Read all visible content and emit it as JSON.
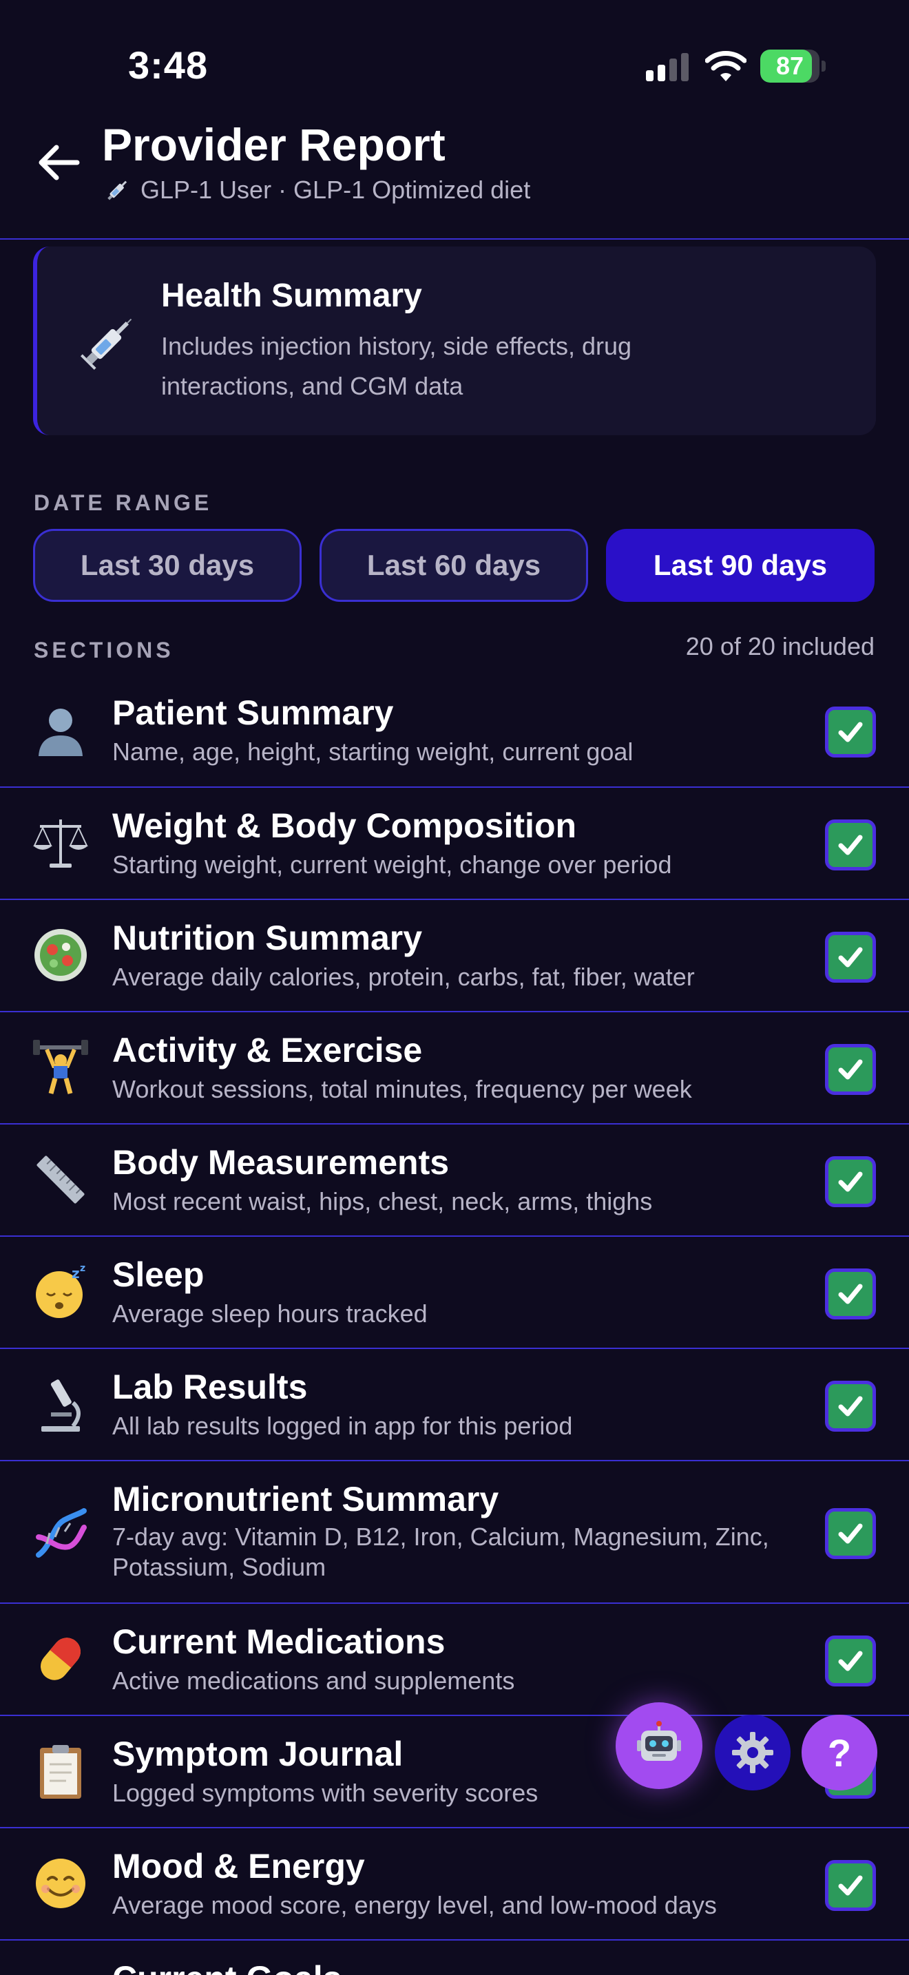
{
  "status_bar": {
    "time": "3:48",
    "battery": "87",
    "battery_level": 0.87
  },
  "header": {
    "title": "Provider Report",
    "subtitle": "GLP-1 User · GLP-1 Optimized diet"
  },
  "health_summary": {
    "title": "Health Summary",
    "description": "Includes injection history, side effects, drug interactions, and CGM data"
  },
  "date_range": {
    "label": "DATE RANGE",
    "options": [
      "Last 30 days",
      "Last 60 days",
      "Last 90 days"
    ],
    "selected": "Last 90 days"
  },
  "sections": {
    "label": "SECTIONS",
    "count_text": "20 of 20 included",
    "items": [
      {
        "icon": "person-icon",
        "title": "Patient Summary",
        "desc": "Name, age, height, starting weight, current goal",
        "checked": true
      },
      {
        "icon": "scale-icon",
        "title": "Weight & Body Composition",
        "desc": "Starting weight, current weight, change over period",
        "checked": true
      },
      {
        "icon": "salad-icon",
        "title": "Nutrition Summary",
        "desc": "Average daily calories, protein, carbs, fat, fiber, water",
        "checked": true
      },
      {
        "icon": "weightlifter-icon",
        "title": "Activity & Exercise",
        "desc": "Workout sessions, total minutes, frequency per week",
        "checked": true
      },
      {
        "icon": "ruler-icon",
        "title": "Body Measurements",
        "desc": "Most recent waist, hips, chest, neck, arms, thighs",
        "checked": true
      },
      {
        "icon": "sleeping-face-icon",
        "title": "Sleep",
        "desc": "Average sleep hours tracked",
        "checked": true
      },
      {
        "icon": "microscope-icon",
        "title": "Lab Results",
        "desc": "All lab results logged in app for this period",
        "checked": true
      },
      {
        "icon": "dna-icon",
        "title": "Micronutrient Summary",
        "desc": "7-day avg: Vitamin D, B12, Iron, Calcium, Magnesium, Zinc, Potassium, Sodium",
        "checked": true
      },
      {
        "icon": "pill-icon",
        "title": "Current Medications",
        "desc": "Active medications and supplements",
        "checked": true
      },
      {
        "icon": "clipboard-icon",
        "title": "Symptom Journal",
        "desc": "Logged symptoms with severity scores",
        "checked": true
      },
      {
        "icon": "smiling-face-icon",
        "title": "Mood & Energy",
        "desc": "Average mood score, energy level, and low-mood days",
        "checked": true
      },
      {
        "icon": "target-icon",
        "title": "Current Goals",
        "desc": "",
        "checked": true
      }
    ]
  },
  "floating_buttons": {
    "assistant": "robot-icon",
    "settings": "gear-icon",
    "help": "?"
  }
}
